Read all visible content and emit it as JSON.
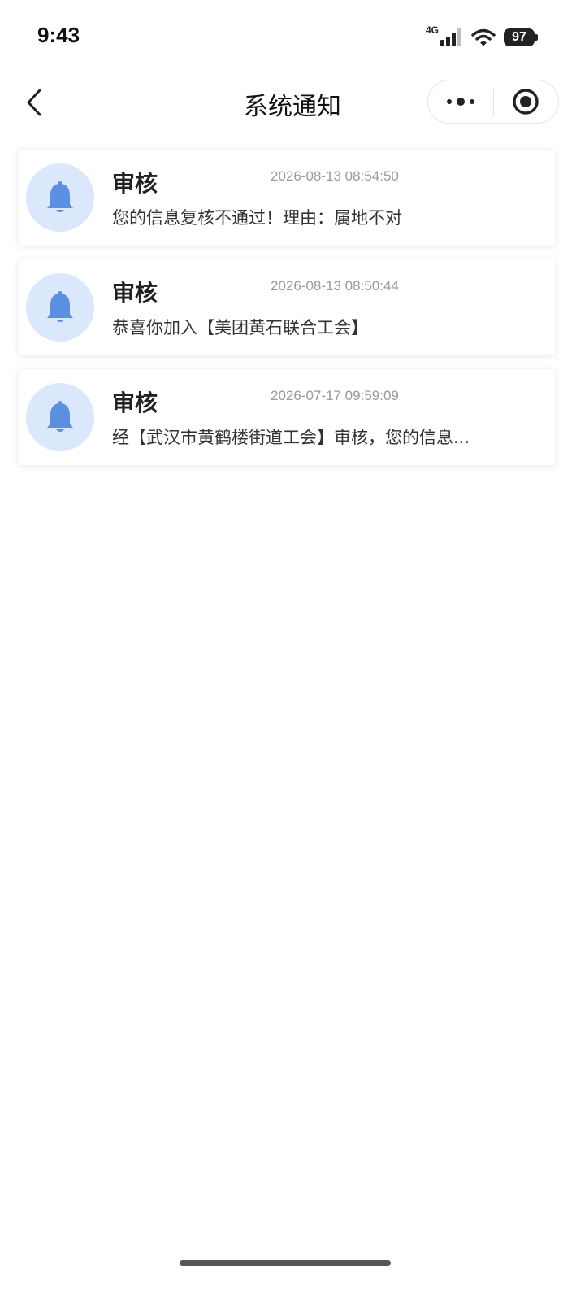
{
  "status_bar": {
    "time": "9:43",
    "network": "4G",
    "battery": "97"
  },
  "nav": {
    "title": "系统通知",
    "back_icon": "chevron-left-icon",
    "more_icon": "more-dots-icon",
    "close_icon": "target-circle-icon"
  },
  "colors": {
    "avatar_bg": "#dbe8fb",
    "bell": "#5b8fe0",
    "time_text": "#9a9a9a"
  },
  "notifications": [
    {
      "icon": "bell-icon",
      "title": "审核",
      "time": "2026-08-13 08:54:50",
      "message": "您的信息复核不通过！理由：属地不对"
    },
    {
      "icon": "bell-icon",
      "title": "审核",
      "time": "2026-08-13 08:50:44",
      "message": "恭喜你加入【美团黄石联合工会】"
    },
    {
      "icon": "bell-icon",
      "title": "审核",
      "time": "2026-07-17 09:59:09",
      "message": "经【武汉市黄鹤楼街道工会】审核，您的信息..."
    }
  ]
}
